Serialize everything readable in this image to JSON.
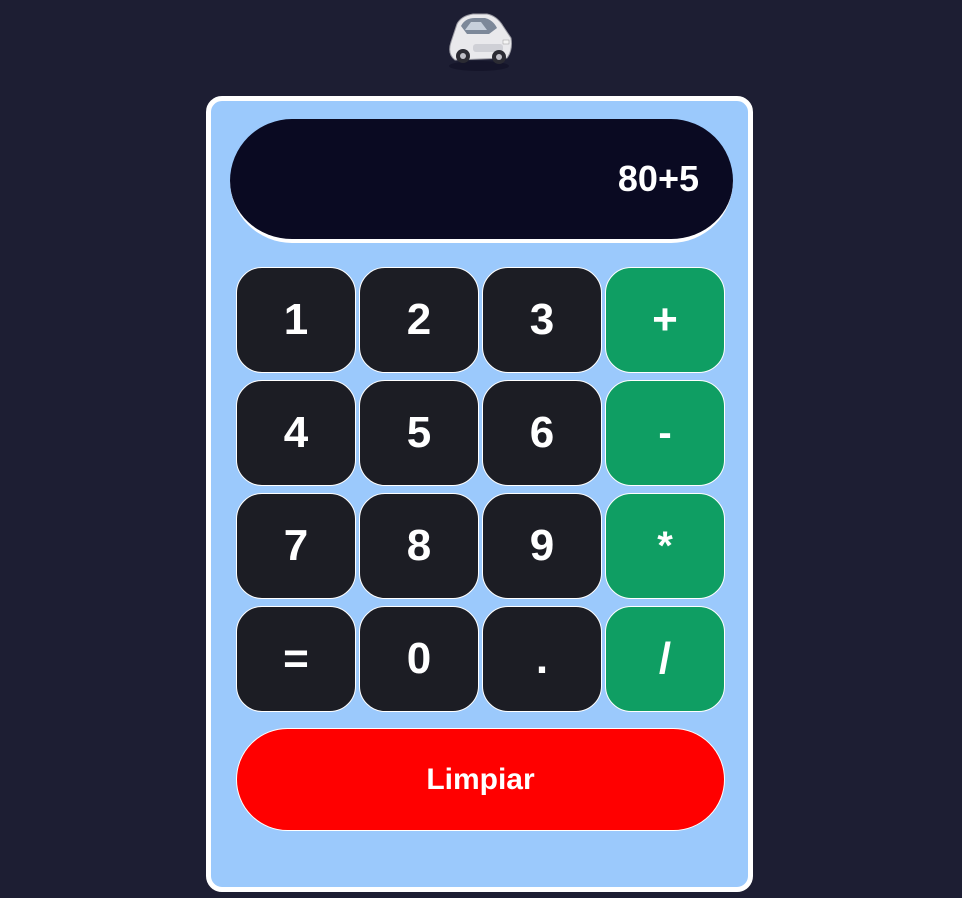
{
  "logo": {
    "icon": "car-icon"
  },
  "display": {
    "value": "80+5"
  },
  "keys": [
    {
      "label": "1",
      "kind": "digit"
    },
    {
      "label": "2",
      "kind": "digit"
    },
    {
      "label": "3",
      "kind": "digit"
    },
    {
      "label": "+",
      "kind": "operator"
    },
    {
      "label": "4",
      "kind": "digit"
    },
    {
      "label": "5",
      "kind": "digit"
    },
    {
      "label": "6",
      "kind": "digit"
    },
    {
      "label": "-",
      "kind": "operator"
    },
    {
      "label": "7",
      "kind": "digit"
    },
    {
      "label": "8",
      "kind": "digit"
    },
    {
      "label": "9",
      "kind": "digit"
    },
    {
      "label": "*",
      "kind": "operator"
    },
    {
      "label": "=",
      "kind": "digit"
    },
    {
      "label": "0",
      "kind": "digit"
    },
    {
      "label": ".",
      "kind": "digit"
    },
    {
      "label": "/",
      "kind": "operator"
    }
  ],
  "clear_button": {
    "label": "Limpiar"
  },
  "colors": {
    "page_background": "#1d1e33",
    "calculator_body": "#9bc9fc",
    "display_background": "#0a0a22",
    "digit_key": "#1c1d24",
    "operator_key": "#0f9e63",
    "clear_key": "#ff0000",
    "text": "#ffffff"
  }
}
